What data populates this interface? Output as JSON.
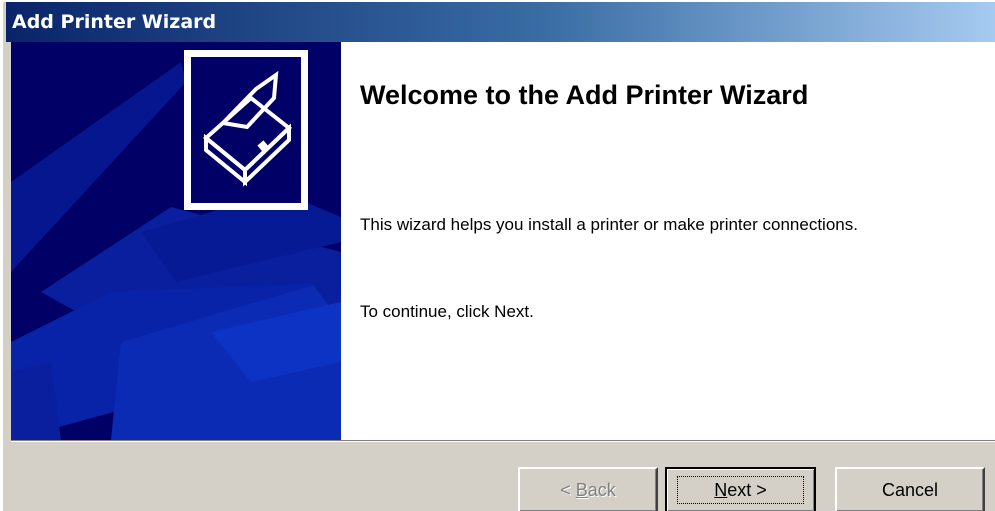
{
  "window": {
    "title": "Add Printer Wizard"
  },
  "sidebar": {
    "icon": "printer-icon"
  },
  "main": {
    "heading": "Welcome to the Add Printer Wizard",
    "description": "This wizard helps you install a printer or make printer connections.",
    "instruction": "To continue, click Next."
  },
  "buttons": {
    "back": {
      "prefix": "< ",
      "mnemonic": "B",
      "rest": "ack",
      "enabled": false
    },
    "next": {
      "mnemonic": "N",
      "rest": "ext >",
      "default": true
    },
    "cancel": {
      "label": "Cancel"
    }
  },
  "colors": {
    "titlebar_start": "#0a246a",
    "titlebar_end": "#a6caf0",
    "sidebar_bg": "#000066",
    "face": "#d4d0c8"
  }
}
